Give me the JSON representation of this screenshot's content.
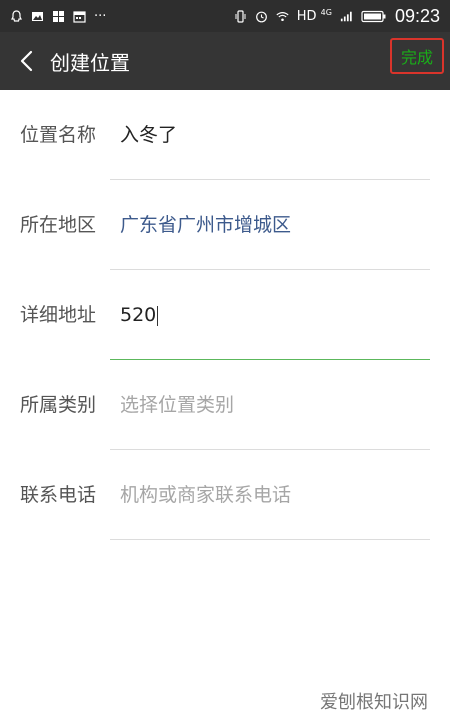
{
  "status_bar": {
    "network": "HD",
    "network_gen": "4G",
    "time": "09:23",
    "overflow": "···"
  },
  "app_bar": {
    "title": "创建位置",
    "done_label": "完成"
  },
  "form": {
    "name": {
      "label": "位置名称",
      "value": "入冬了"
    },
    "region": {
      "label": "所在地区",
      "value": "广东省广州市增城区"
    },
    "address": {
      "label": "详细地址",
      "value": "520"
    },
    "category": {
      "label": "所属类别",
      "placeholder": "选择位置类别"
    },
    "phone": {
      "label": "联系电话",
      "placeholder": "机构或商家联系电话"
    }
  },
  "watermark": "爱刨根知识网",
  "colors": {
    "status_bar_bg": "#2e2e2e",
    "app_bar_bg": "#353535",
    "done_text": "#1aad19",
    "done_border": "#d9342b",
    "region_text": "#3d5a8c",
    "active_underline": "#5cb85c"
  }
}
